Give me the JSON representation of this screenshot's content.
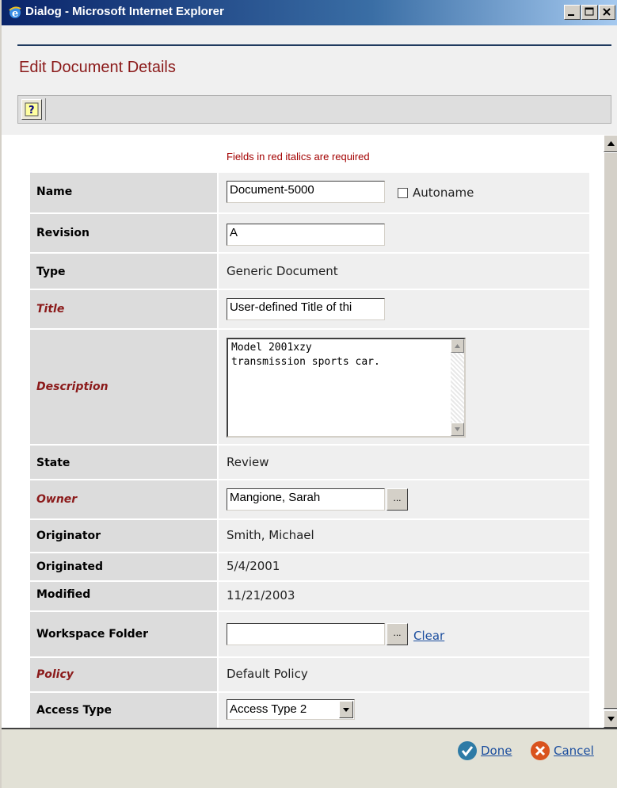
{
  "window": {
    "title": "Dialog - Microsoft Internet Explorer"
  },
  "page": {
    "title": "Edit Document Details",
    "required_note": "Fields in red italics are required"
  },
  "fields": {
    "name": {
      "label": "Name",
      "value": "Document-5000",
      "autoname_label": "Autoname",
      "autoname_checked": false
    },
    "revision": {
      "label": "Revision",
      "value": "A"
    },
    "type": {
      "label": "Type",
      "value": "Generic Document"
    },
    "title": {
      "label": "Title",
      "value": "User-defined Title of thi"
    },
    "description": {
      "label": "Description",
      "line1": "Model 2001xzy",
      "line2": "transmission sports car."
    },
    "state": {
      "label": "State",
      "value": "Review"
    },
    "owner": {
      "label": "Owner",
      "value": "Mangione, Sarah",
      "browse_label": "..."
    },
    "originator": {
      "label": "Originator",
      "value": "Smith, Michael"
    },
    "originated": {
      "label": "Originated",
      "value": "5/4/2001"
    },
    "modified": {
      "label": "Modified",
      "value": "11/21/2003"
    },
    "workspace_folder": {
      "label": "Workspace Folder",
      "value": "",
      "browse_label": "...",
      "clear_label": "Clear"
    },
    "policy": {
      "label": "Policy",
      "value": "Default Policy"
    },
    "access_type": {
      "label": "Access Type",
      "value": "Access Type 2"
    }
  },
  "footer": {
    "done_label": "Done",
    "cancel_label": "Cancel"
  },
  "colors": {
    "required_label": "#8b1a1a",
    "link": "#1c4e9e",
    "titlebar": "#0a246a",
    "done_icon": "#2e7ba6",
    "cancel_icon": "#d9531e"
  },
  "icons": {
    "window": "ie-icon",
    "help": "help-icon",
    "done": "check-icon",
    "cancel": "close-icon"
  }
}
